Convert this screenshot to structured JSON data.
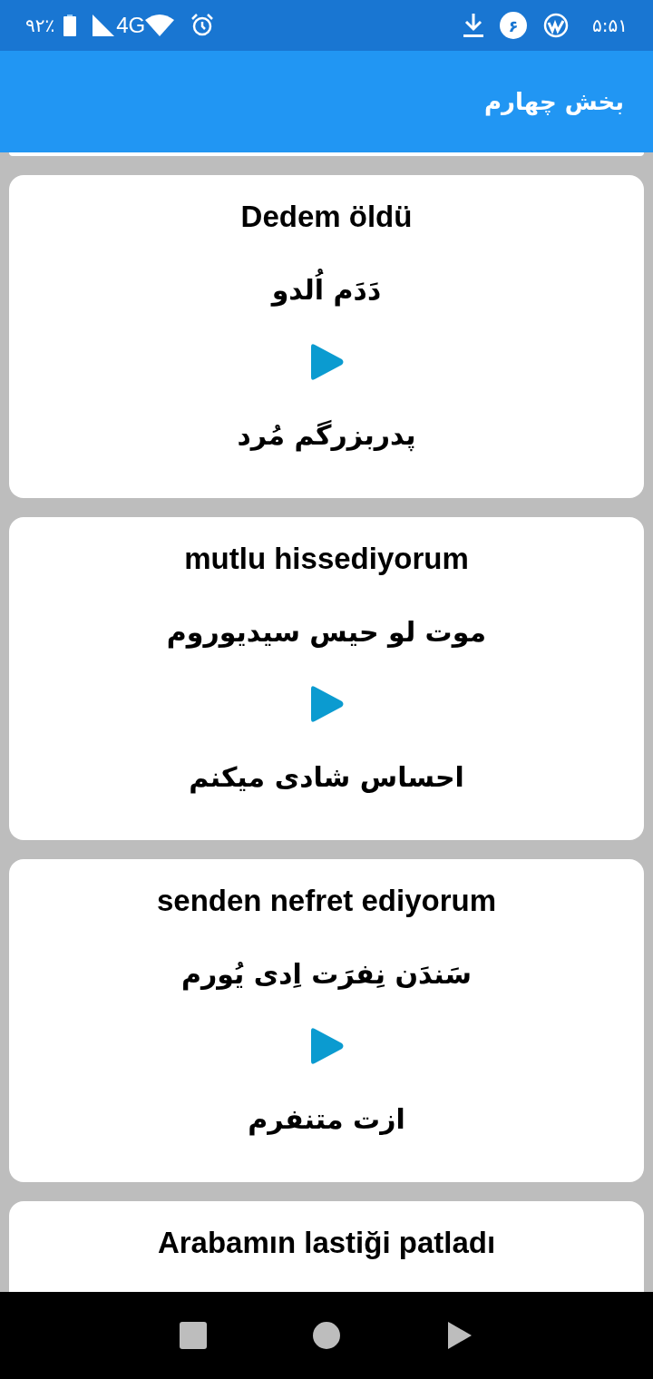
{
  "status_bar": {
    "battery": "۹۲٪",
    "network": "4G",
    "notification_count": "۶",
    "time": "۵:۵۱"
  },
  "app_bar": {
    "title": "بخش چهارم"
  },
  "cards": [
    {
      "phrase": "Dedem öldü",
      "pronunciation": "دَدَم اُلدو",
      "translation": "پدربزرگم مُرد"
    },
    {
      "phrase": "mutlu hissediyorum",
      "pronunciation": "موت لو حیس سیدیوروم",
      "translation": "احساس شادی میکنم"
    },
    {
      "phrase": "senden nefret ediyorum",
      "pronunciation": "سَندَن نِفرَت اِدی یُورم",
      "translation": "ازت متنفرم"
    },
    {
      "phrase": "Arabamın lastiği patladı"
    }
  ]
}
